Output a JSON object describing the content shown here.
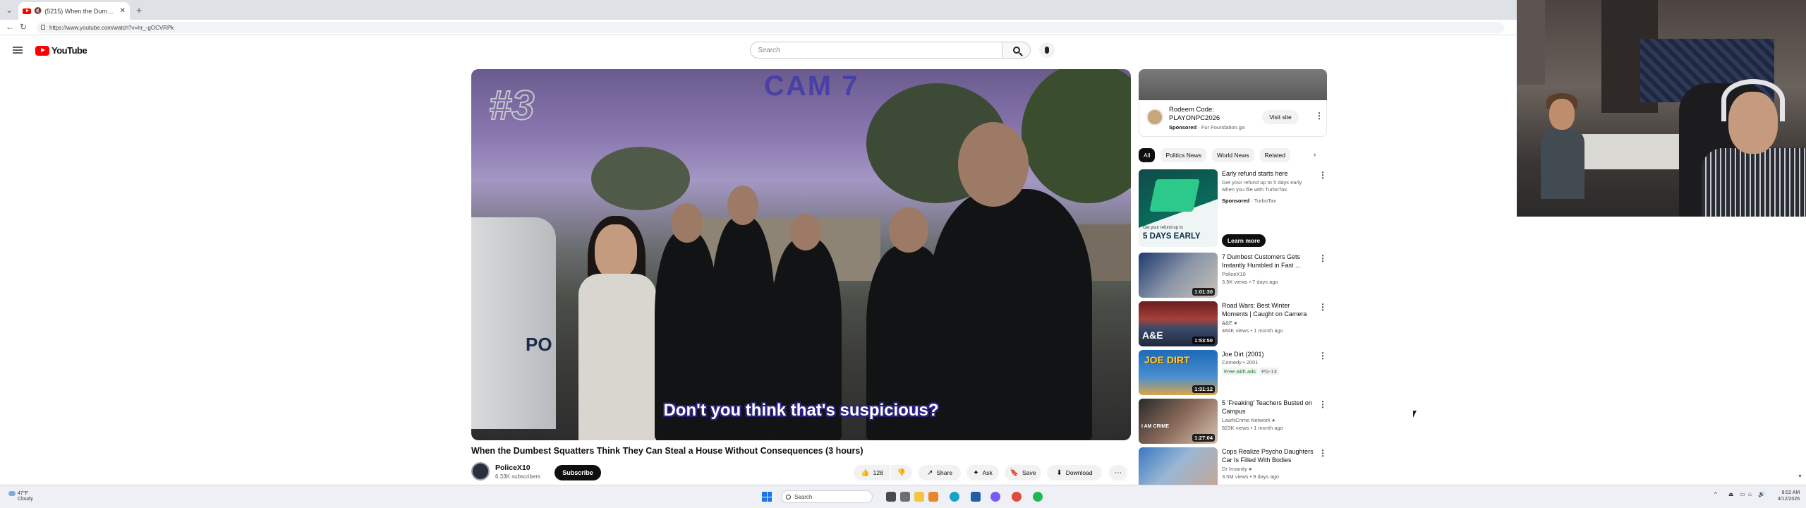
{
  "browser": {
    "tab_title": "(5215) When the Dumbest S...",
    "url": "https://www.youtube.com/watch?v=hr_-gOCVRPk"
  },
  "youtube": {
    "logo_text": "YouTube",
    "search_placeholder": "Search"
  },
  "player": {
    "overlay_number": "#3",
    "overlay_label": "CAM 7",
    "caption": "Don't you think that's suspicious?",
    "van_text": "PO"
  },
  "video": {
    "title": "When the Dumbest Squatters Think They Can Steal a House Without Consequences (3 hours)",
    "channel_name": "PoliceX10",
    "subscribers": "6.33K subscribers",
    "subscribe_label": "Subscribe",
    "like_count": "128",
    "share_label": "Share",
    "ask_label": "Ask",
    "save_label": "Save",
    "download_label": "Download"
  },
  "ad": {
    "title": "Rodeem Code: PLAYONPC2026",
    "sponsored": "Sponsored",
    "domain": "Fur Foundation.ga",
    "visit_label": "Visit site"
  },
  "chips": [
    "All",
    "Politics News",
    "World News",
    "Related"
  ],
  "promo": {
    "title": "Early refund starts here",
    "desc": "Get your refund up to 5 days early when you file with TurboTax.",
    "sponsored": "Sponsored",
    "brand": "TurboTax",
    "learn_label": "Learn more",
    "thumb_text": "5 DAYS EARLY",
    "thumb_small": "Get your refund up to"
  },
  "recommendations": [
    {
      "title": "7 Dumbest Customers Gets Instantly Humbled in Fast ...",
      "channel": "PoliceX10",
      "meta": "3.5K views • 7 days ago",
      "duration": "1:01:30"
    },
    {
      "title": "Road Wars: Best Winter Moments | Caught on Camera ...",
      "channel": "A&E",
      "meta": "484K views • 1 month ago",
      "duration": "1:53:50",
      "thumb_text": "A&E"
    },
    {
      "title": "Joe Dirt (2001)",
      "channel": "Comedy • 2001",
      "meta": "",
      "tag1": "Free with ads",
      "tag2": "PG-13",
      "duration": "1:31:12",
      "thumb_text": "JOE DIRT"
    },
    {
      "title": "5 'Freaking' Teachers Busted on Campus",
      "channel": "LawNCrime Network",
      "meta": "823K views • 1 month ago",
      "duration": "1:27:04",
      "thumb_text": "I AM CRIME"
    },
    {
      "title": "Cops Realize Psycho Daughters Car Is Filled With Bodies",
      "channel": "Dr Insanity",
      "meta": "3.5M views • 9 days ago",
      "duration": ""
    }
  ],
  "taskbar": {
    "temp": "47°F",
    "weather": "Cloudy",
    "search_label": "Search",
    "time": "8:02 AM",
    "date": "4/12/2026"
  },
  "colors": {
    "youtube_red": "#ff0000",
    "caption_outline": "#2a2580",
    "taskbar_bg": "#eef0f5"
  }
}
